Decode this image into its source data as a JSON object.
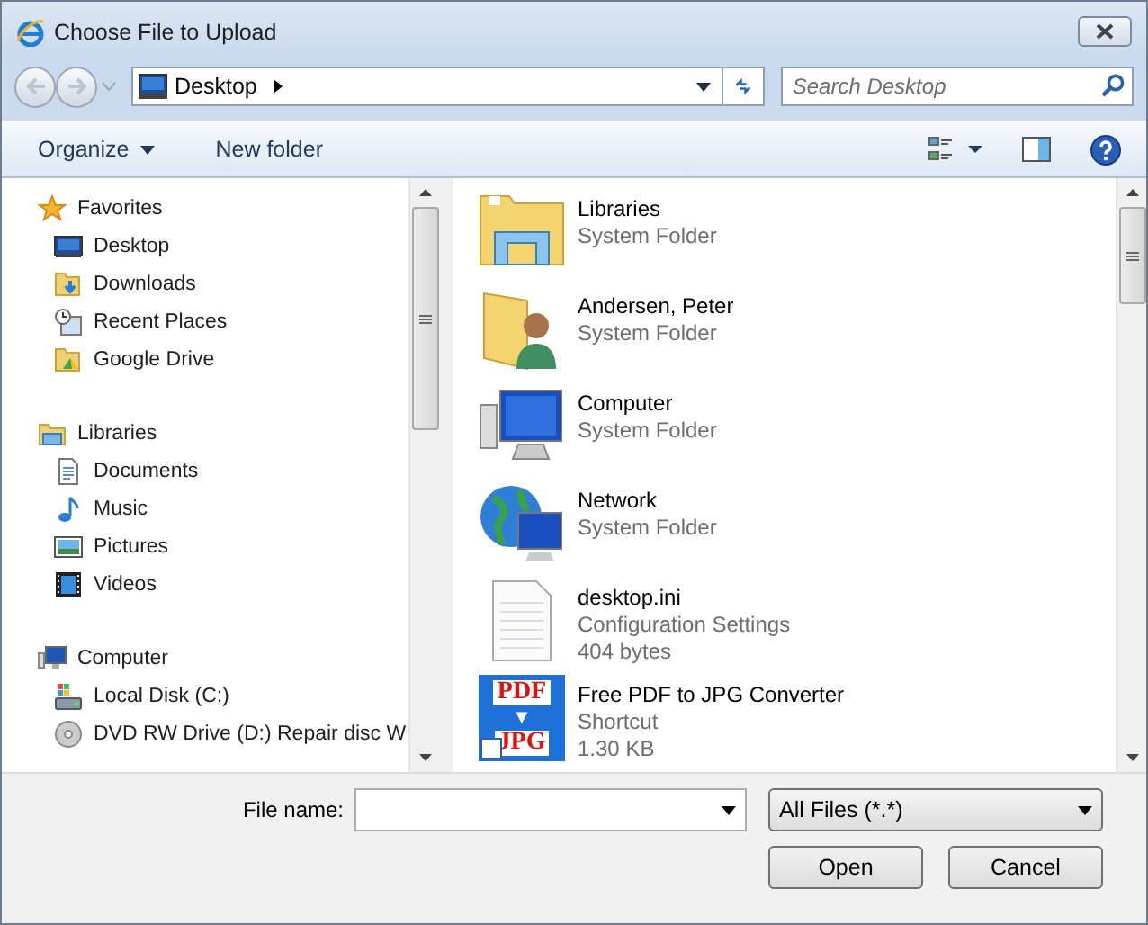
{
  "window": {
    "title": "Choose File to Upload"
  },
  "address": {
    "location": "Desktop",
    "search_placeholder": "Search Desktop"
  },
  "toolbar": {
    "organize": "Organize",
    "new_folder": "New folder"
  },
  "navigation": [
    {
      "label": "Favorites",
      "kind": "star",
      "children": [
        {
          "label": "Desktop",
          "kind": "desktop"
        },
        {
          "label": "Downloads",
          "kind": "downloads"
        },
        {
          "label": "Recent Places",
          "kind": "recent"
        },
        {
          "label": "Google Drive",
          "kind": "drive"
        }
      ]
    },
    {
      "label": "Libraries",
      "kind": "library",
      "children": [
        {
          "label": "Documents",
          "kind": "document"
        },
        {
          "label": "Music",
          "kind": "music"
        },
        {
          "label": "Pictures",
          "kind": "picture"
        },
        {
          "label": "Videos",
          "kind": "video"
        }
      ]
    },
    {
      "label": "Computer",
      "kind": "computer",
      "children": [
        {
          "label": "Local Disk (C:)",
          "kind": "disk"
        },
        {
          "label": "DVD RW Drive (D:) Repair disc W",
          "kind": "dvd"
        }
      ]
    }
  ],
  "files": [
    {
      "name": "Libraries",
      "details": [
        "System Folder"
      ],
      "kind": "library"
    },
    {
      "name": "Andersen, Peter",
      "details": [
        "System Folder"
      ],
      "kind": "user"
    },
    {
      "name": "Computer",
      "details": [
        "System Folder"
      ],
      "kind": "computer"
    },
    {
      "name": "Network",
      "details": [
        "System Folder"
      ],
      "kind": "network"
    },
    {
      "name": "desktop.ini",
      "details": [
        "Configuration Settings",
        "404 bytes"
      ],
      "kind": "text"
    },
    {
      "name": "Free PDF to JPG Converter",
      "details": [
        "Shortcut",
        "1.30 KB"
      ],
      "kind": "shortcut",
      "icon_text": [
        "PDF",
        "▼",
        "JPG"
      ]
    }
  ],
  "footer": {
    "file_name_label": "File name:",
    "file_type": "All Files (*.*)",
    "open": "Open",
    "cancel": "Cancel"
  }
}
